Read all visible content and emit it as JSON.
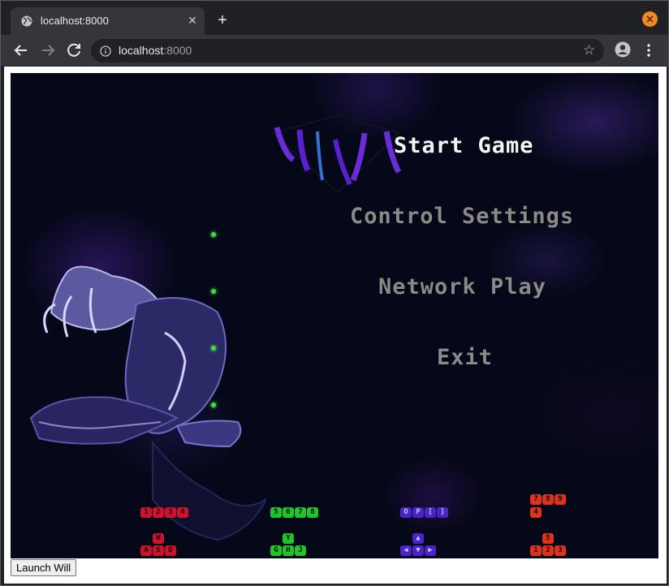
{
  "browser": {
    "tab_title": "localhost:8000",
    "url_host": "localhost",
    "url_port": ":8000",
    "new_tab_glyph": "+",
    "tab_close_glyph": "✕",
    "star_glyph": "☆"
  },
  "game": {
    "menu": {
      "start": "Start Game",
      "control": "Control Settings",
      "network": "Network Play",
      "exit": "Exit"
    },
    "key_groups": {
      "p1_top": [
        "1",
        "2",
        "3",
        "4"
      ],
      "p1_up": [
        "W"
      ],
      "p1_bottom": [
        "A",
        "S",
        "D"
      ],
      "p2_top": [
        "5",
        "6",
        "7",
        "8"
      ],
      "p2_up": [
        "Y"
      ],
      "p2_bottom": [
        "G",
        "H",
        "J"
      ],
      "p3_top": [
        "O",
        "P",
        "[",
        "]"
      ],
      "p3_up": [
        "▲"
      ],
      "p3_bottom": [
        "◀",
        "▼",
        "▶"
      ],
      "p4_top_a": [
        "7",
        "8",
        "9"
      ],
      "p4_top_b": [
        "4"
      ],
      "p4_up": [
        "5"
      ],
      "p4_bottom": [
        "1",
        "2",
        "3"
      ]
    },
    "colors": {
      "p1": "#d0112b",
      "p2": "#1fc42a",
      "p3": "#4a23c9",
      "p4": "#e0311c",
      "menu_active": "#f5f5f5",
      "menu_inactive": "#8a8a8a"
    }
  },
  "page": {
    "launch_button": "Launch Will"
  }
}
